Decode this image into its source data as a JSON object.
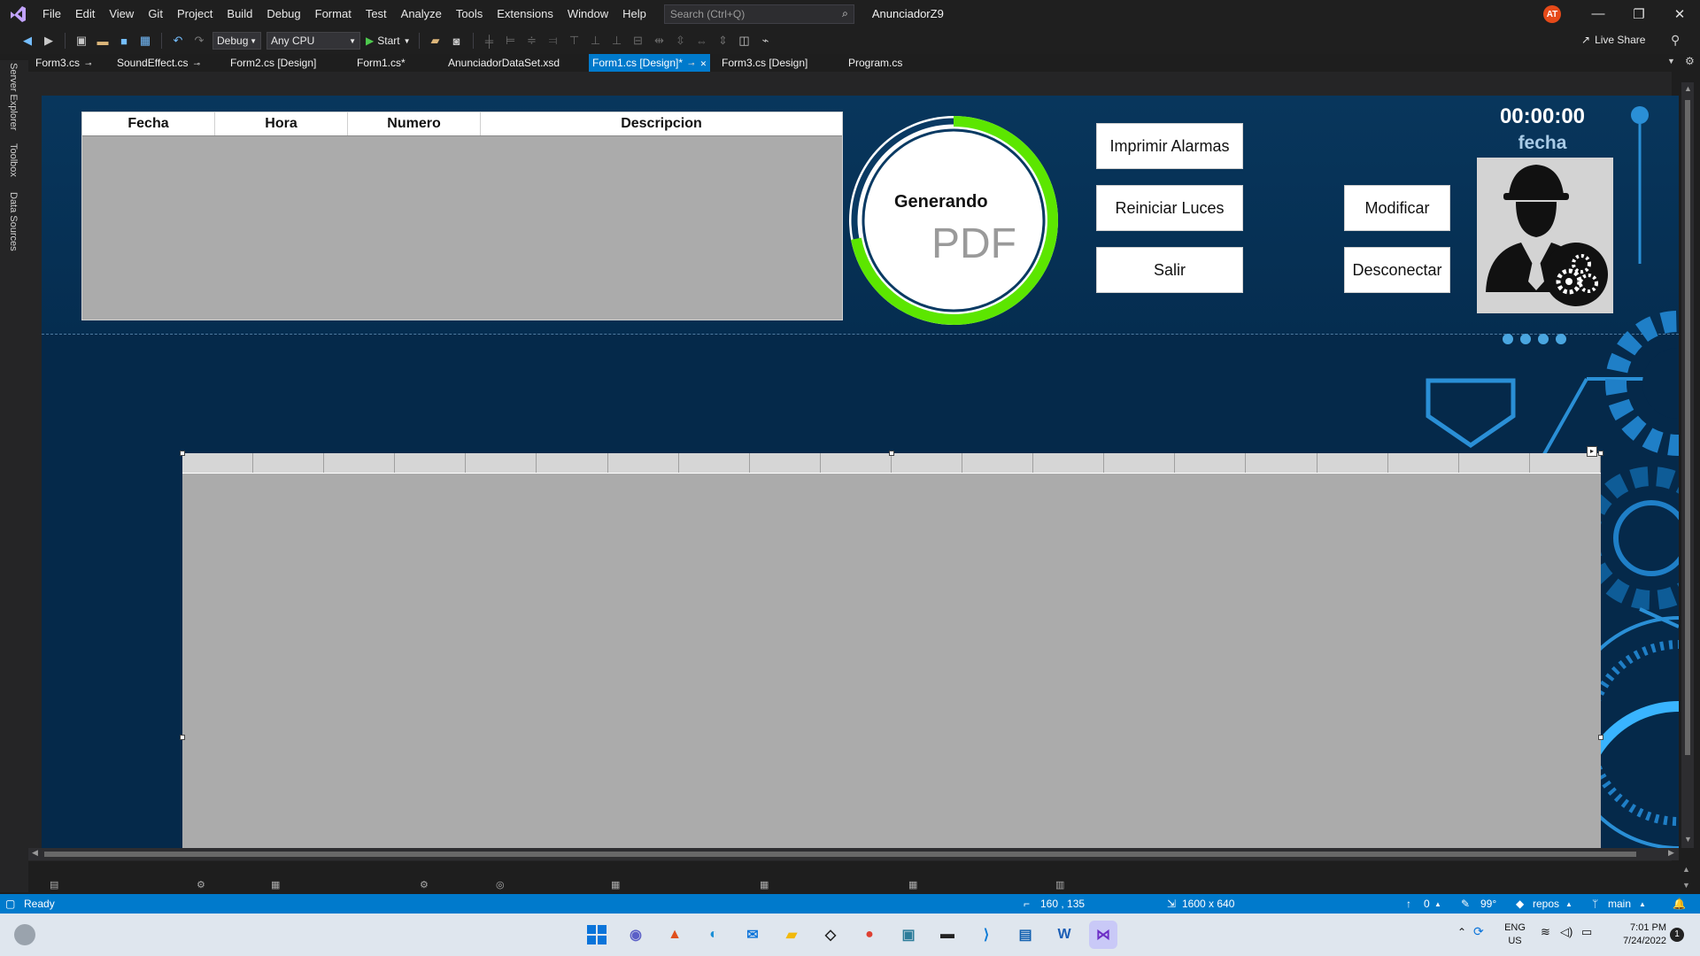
{
  "app": {
    "menu": [
      "File",
      "Edit",
      "View",
      "Git",
      "Project",
      "Build",
      "Debug",
      "Format",
      "Test",
      "Analyze",
      "Tools",
      "Extensions",
      "Window",
      "Help"
    ],
    "search_placeholder": "Search (Ctrl+Q)",
    "solution_name": "AnunciadorZ9",
    "user_initials": "AT",
    "window_controls": {
      "minimize": "—",
      "maximize": "❐",
      "close": "✕"
    }
  },
  "toolbar": {
    "configuration": "Debug",
    "platform": "Any CPU",
    "start_label": "Start",
    "live_share": "Live Share"
  },
  "tabs": [
    {
      "label": "Form3.cs",
      "pinned": true
    },
    {
      "label": "SoundEffect.cs",
      "pinned": true
    },
    {
      "label": "Form2.cs [Design]"
    },
    {
      "label": "Form1.cs*"
    },
    {
      "label": "AnunciadorDataSet.xsd"
    },
    {
      "label": "Form1.cs [Design]*",
      "active": true
    },
    {
      "label": "Form3.cs [Design]"
    },
    {
      "label": "Program.cs"
    }
  ],
  "side_panels": [
    "Server Explorer",
    "Toolbox",
    "Data Sources"
  ],
  "form": {
    "alarm_grid": {
      "columns": [
        "Fecha",
        "Hora",
        "Numero",
        "Descripcion"
      ]
    },
    "progress": {
      "title": "Generando",
      "subtitle": "PDF",
      "value": 0.72
    },
    "buttons": {
      "imprimir": "Imprimir Alarmas",
      "reiniciar": "Reiniciar Luces",
      "salir": "Salir",
      "modificar": "Modificar",
      "desconectar": "Desconectar"
    },
    "clock": "00:00:00",
    "date_label": "fecha",
    "big_grid_columns": 20
  },
  "status_bar": {
    "state": "Ready",
    "location": "160 , 135",
    "size": "1600 x 640",
    "pending": "0",
    "zoom": "99°",
    "repo": "repos",
    "branch": "main"
  },
  "taskbar": {
    "language": "ENG",
    "region": "US",
    "time": "7:01 PM",
    "date": "7/24/2022",
    "notifications": "1"
  },
  "colors": {
    "accent": "#007acc",
    "form_bg": "#05294a",
    "ring_green": "#5ce600",
    "grid_gray": "#ababab"
  }
}
